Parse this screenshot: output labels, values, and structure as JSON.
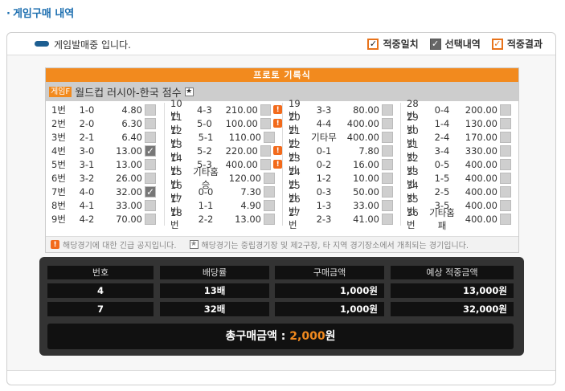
{
  "page": {
    "title": "게임구매 내역"
  },
  "status": {
    "text": "게임발매중 입니다."
  },
  "legend": [
    {
      "label": "적중일치",
      "style": "o"
    },
    {
      "label": "선택내역",
      "style": "g"
    },
    {
      "label": "적중결과",
      "style": "ol"
    }
  ],
  "proto": {
    "header": "프로토 기록식"
  },
  "game": {
    "tag": "게임F",
    "name": "월드컵 러시아-한국 점수",
    "star": "★"
  },
  "columns": [
    [
      {
        "no": "1번",
        "score": "1-0",
        "odds": "4.80",
        "sel": false,
        "warn": false
      },
      {
        "no": "2번",
        "score": "2-0",
        "odds": "6.30",
        "sel": false,
        "warn": false
      },
      {
        "no": "3번",
        "score": "2-1",
        "odds": "6.40",
        "sel": false,
        "warn": false
      },
      {
        "no": "4번",
        "score": "3-0",
        "odds": "13.00",
        "sel": true,
        "warn": false
      },
      {
        "no": "5번",
        "score": "3-1",
        "odds": "13.00",
        "sel": false,
        "warn": false
      },
      {
        "no": "6번",
        "score": "3-2",
        "odds": "26.00",
        "sel": false,
        "warn": false
      },
      {
        "no": "7번",
        "score": "4-0",
        "odds": "32.00",
        "sel": true,
        "warn": false
      },
      {
        "no": "8번",
        "score": "4-1",
        "odds": "33.00",
        "sel": false,
        "warn": false
      },
      {
        "no": "9번",
        "score": "4-2",
        "odds": "70.00",
        "sel": false,
        "warn": false
      }
    ],
    [
      {
        "no": "10번",
        "score": "4-3",
        "odds": "210.00",
        "sel": false,
        "warn": true
      },
      {
        "no": "11번",
        "score": "5-0",
        "odds": "100.00",
        "sel": false,
        "warn": true
      },
      {
        "no": "12번",
        "score": "5-1",
        "odds": "110.00",
        "sel": false,
        "warn": false
      },
      {
        "no": "13번",
        "score": "5-2",
        "odds": "220.00",
        "sel": false,
        "warn": true
      },
      {
        "no": "14번",
        "score": "5-3",
        "odds": "400.00",
        "sel": false,
        "warn": true
      },
      {
        "no": "15번",
        "score": "기타홈승",
        "odds": "120.00",
        "sel": false,
        "warn": false
      },
      {
        "no": "16번",
        "score": "0-0",
        "odds": "7.30",
        "sel": false,
        "warn": false
      },
      {
        "no": "17번",
        "score": "1-1",
        "odds": "4.90",
        "sel": false,
        "warn": false
      },
      {
        "no": "18번",
        "score": "2-2",
        "odds": "13.00",
        "sel": false,
        "warn": false
      }
    ],
    [
      {
        "no": "19번",
        "score": "3-3",
        "odds": "80.00",
        "sel": false,
        "warn": false
      },
      {
        "no": "20번",
        "score": "4-4",
        "odds": "400.00",
        "sel": false,
        "warn": false
      },
      {
        "no": "21번",
        "score": "기타무",
        "odds": "400.00",
        "sel": false,
        "warn": false
      },
      {
        "no": "22번",
        "score": "0-1",
        "odds": "7.80",
        "sel": false,
        "warn": false
      },
      {
        "no": "23번",
        "score": "0-2",
        "odds": "16.00",
        "sel": false,
        "warn": false
      },
      {
        "no": "24번",
        "score": "1-2",
        "odds": "10.00",
        "sel": false,
        "warn": false
      },
      {
        "no": "25번",
        "score": "0-3",
        "odds": "50.00",
        "sel": false,
        "warn": false
      },
      {
        "no": "26번",
        "score": "1-3",
        "odds": "33.00",
        "sel": false,
        "warn": false
      },
      {
        "no": "27번",
        "score": "2-3",
        "odds": "41.00",
        "sel": false,
        "warn": false
      }
    ],
    [
      {
        "no": "28번",
        "score": "0-4",
        "odds": "200.00",
        "sel": false,
        "warn": false
      },
      {
        "no": "29번",
        "score": "1-4",
        "odds": "130.00",
        "sel": false,
        "warn": false
      },
      {
        "no": "30번",
        "score": "2-4",
        "odds": "170.00",
        "sel": false,
        "warn": false
      },
      {
        "no": "31번",
        "score": "3-4",
        "odds": "330.00",
        "sel": false,
        "warn": false
      },
      {
        "no": "32번",
        "score": "0-5",
        "odds": "400.00",
        "sel": false,
        "warn": false
      },
      {
        "no": "33번",
        "score": "1-5",
        "odds": "400.00",
        "sel": false,
        "warn": false
      },
      {
        "no": "34번",
        "score": "2-5",
        "odds": "400.00",
        "sel": false,
        "warn": false
      },
      {
        "no": "35번",
        "score": "3-5",
        "odds": "400.00",
        "sel": false,
        "warn": false
      },
      {
        "no": "36번",
        "score": "기타홈패",
        "odds": "400.00",
        "sel": false,
        "warn": false
      }
    ]
  ],
  "notice": {
    "warn_text": "해당경기에 대한 긴급 공지입니다.",
    "star_text": "해당경기는 중립경기장 및 제2구장, 타 지역 경기장소에서 개최되는 경기입니다."
  },
  "summary": {
    "headers": [
      "번호",
      "배당률",
      "구매금액",
      "예상 적중금액"
    ],
    "rows": [
      {
        "no": "4",
        "odds": "13배",
        "amount": "1,000원",
        "expected": "13,000원"
      },
      {
        "no": "7",
        "odds": "32배",
        "amount": "1,000원",
        "expected": "32,000원"
      }
    ],
    "total_label": "총구매금액 : ",
    "total_amount": "2,000",
    "total_unit": "원"
  }
}
